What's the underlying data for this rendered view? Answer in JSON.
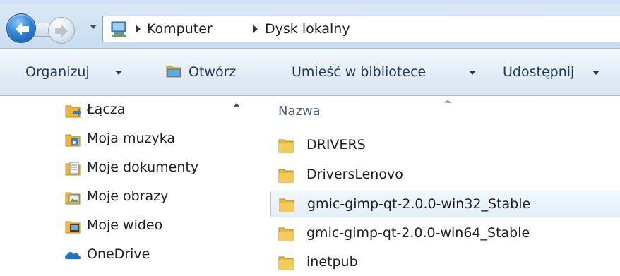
{
  "address_bar": {
    "breadcrumbs": [
      "Komputer",
      "Dysk lokalny"
    ]
  },
  "toolbar": {
    "organize_label": "Organizuj",
    "open_label": "Otwórz",
    "include_library_label": "Umieść w bibliotece",
    "share_label": "Udostępnij"
  },
  "nav_pane": {
    "items": [
      {
        "label": "Łącza",
        "icon": "links-folder-icon"
      },
      {
        "label": "Moja muzyka",
        "icon": "music-folder-icon"
      },
      {
        "label": "Moje dokumenty",
        "icon": "documents-folder-icon"
      },
      {
        "label": "Moje obrazy",
        "icon": "pictures-folder-icon"
      },
      {
        "label": "Moje wideo",
        "icon": "videos-folder-icon"
      },
      {
        "label": "OneDrive",
        "icon": "onedrive-cloud-icon"
      }
    ]
  },
  "file_list": {
    "column_header": "Nazwa",
    "rows": [
      {
        "name": "DRIVERS",
        "selected": false
      },
      {
        "name": "DriversLenovo",
        "selected": false
      },
      {
        "name": "gmic-gimp-qt-2.0.0-win32_Stable",
        "selected": true
      },
      {
        "name": "gmic-gimp-qt-2.0.0-win64_Stable",
        "selected": false
      },
      {
        "name": "inetpub",
        "selected": false
      }
    ]
  },
  "colors": {
    "folder_yellow": "#e8b93f",
    "selection_border": "#a8c8e4",
    "toolbar_text": "#1e395b"
  }
}
